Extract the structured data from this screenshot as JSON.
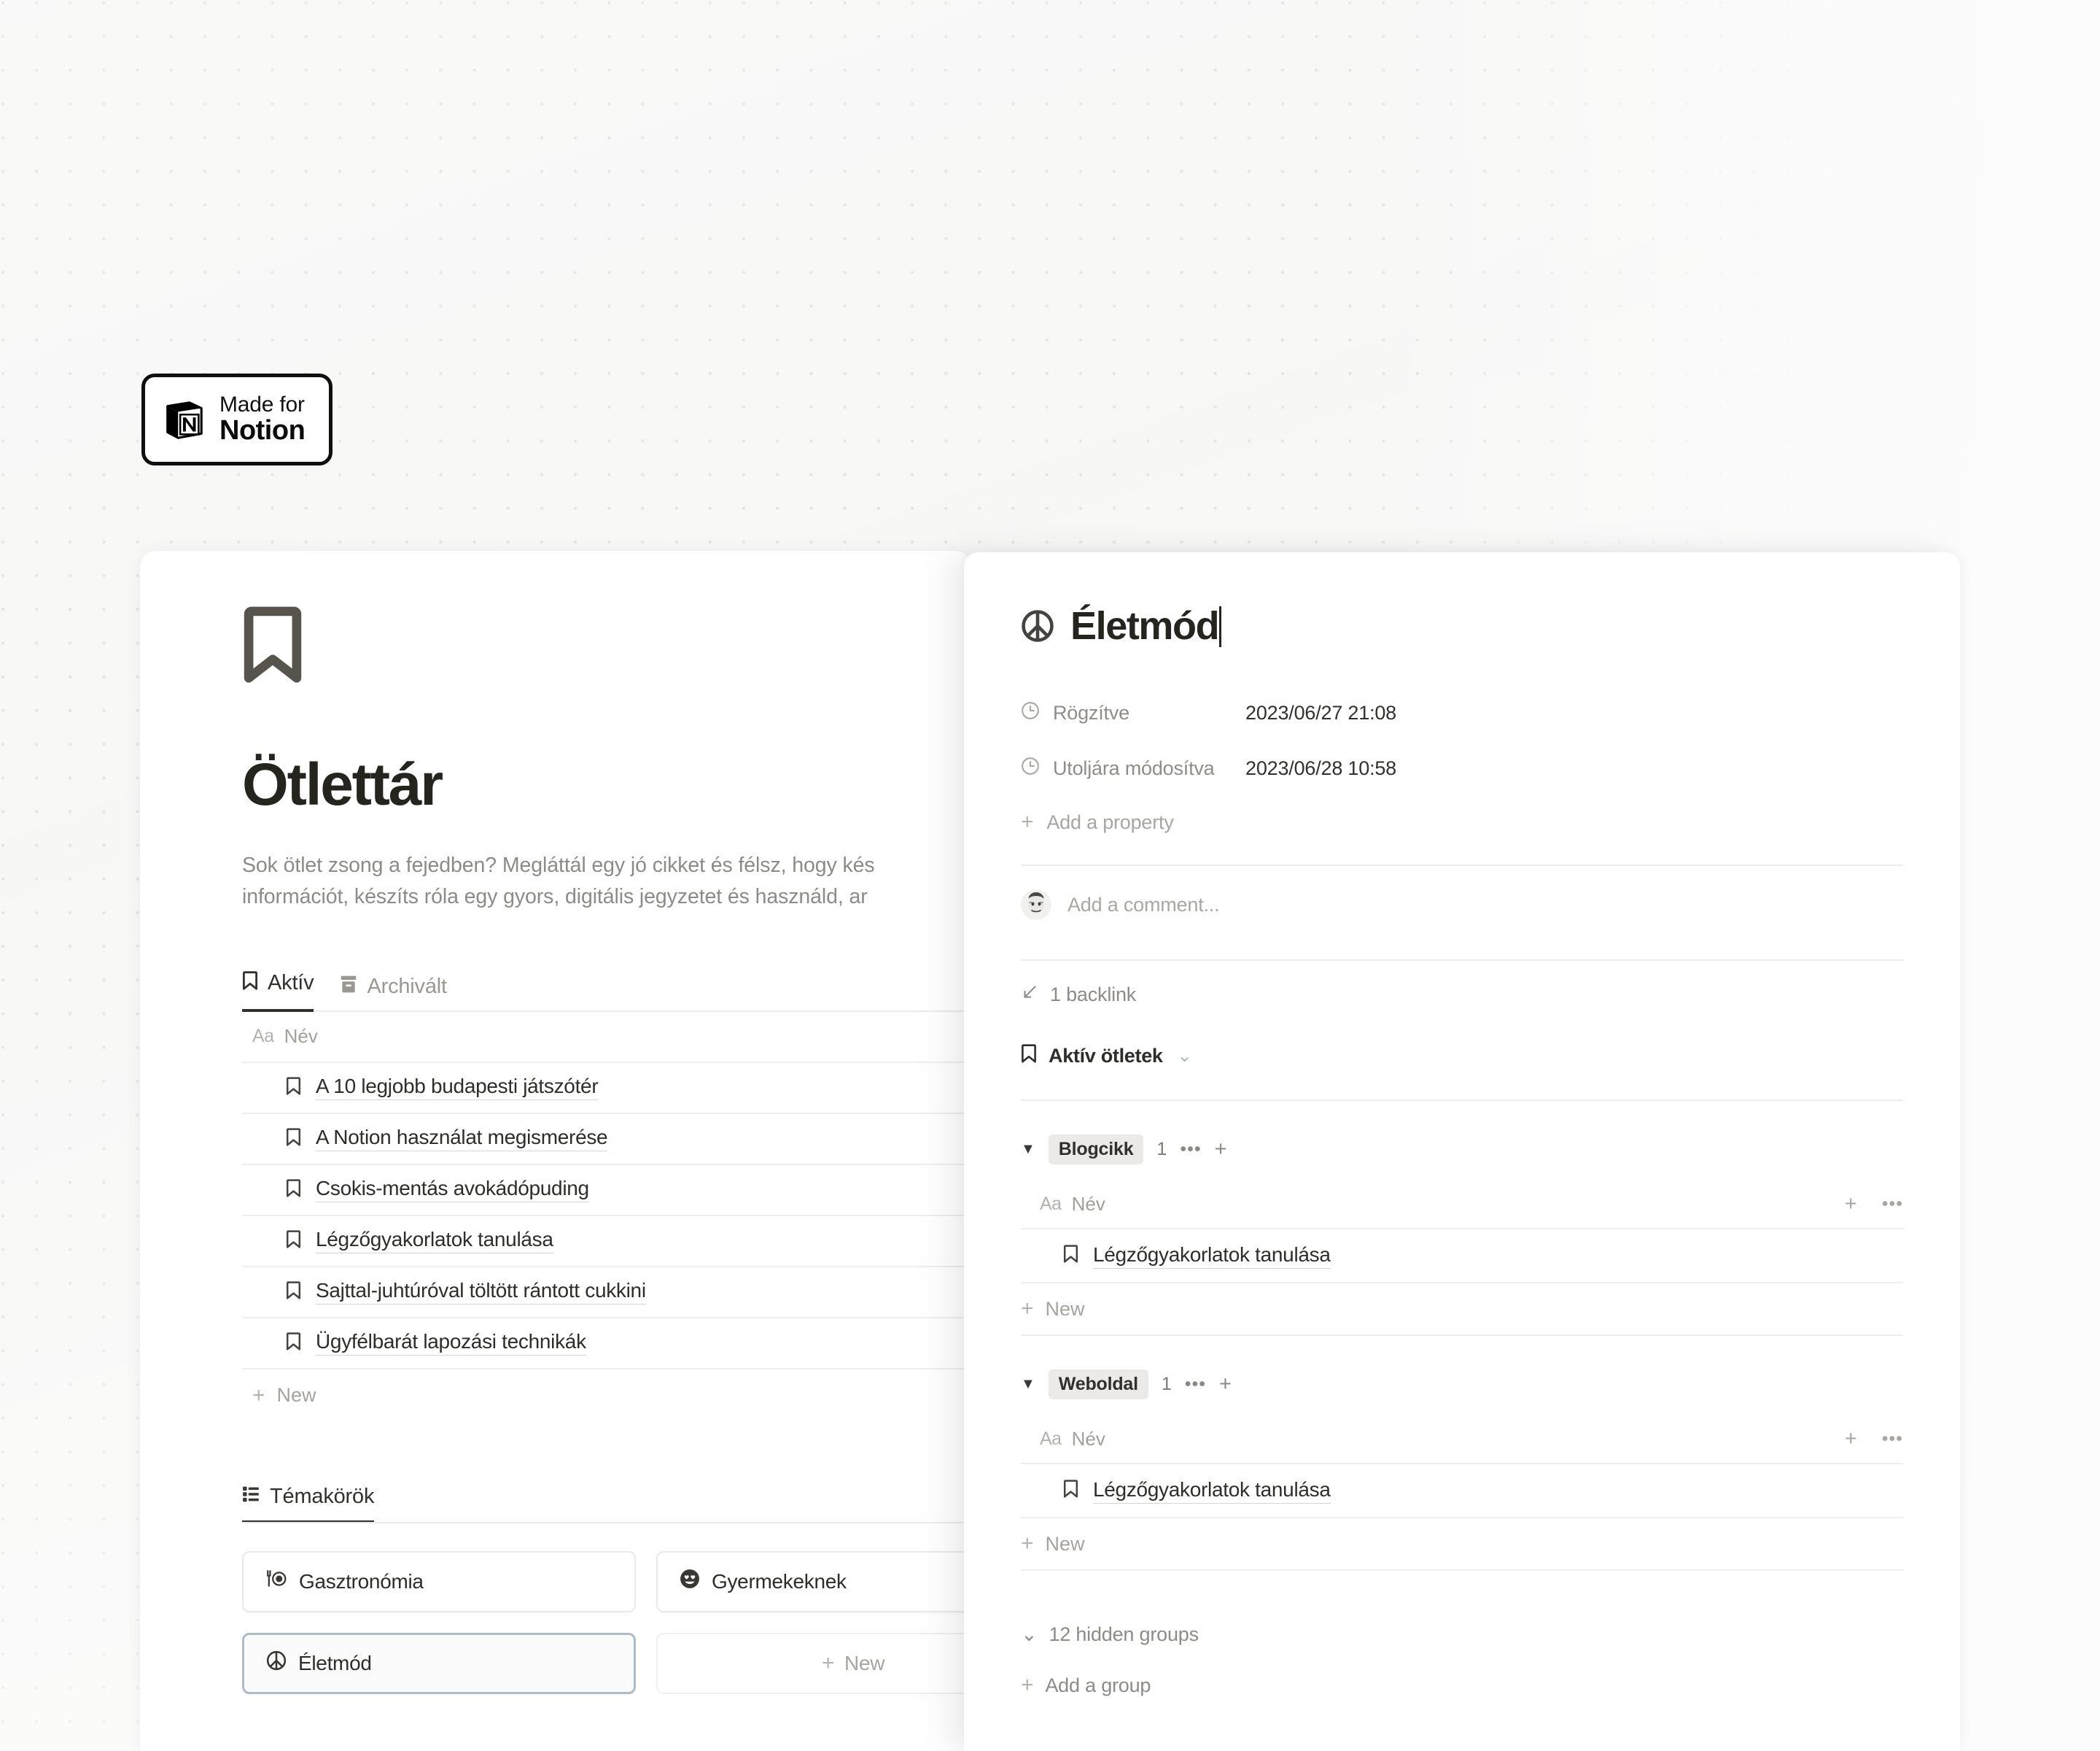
{
  "badge": {
    "line1": "Made for",
    "line2": "Notion",
    "logo_icon": "notion-logo-icon"
  },
  "left_page": {
    "hero_icon": "bookmark-icon",
    "title": "Ötlettár",
    "description_line1": "Sok ötlet zsong a fejedben? Megláttál egy jó cikket és félsz, hogy kés",
    "description_line2": "információt, készíts róla egy gyors, digitális jegyzetet és használd, ar",
    "tabs": [
      {
        "label": "Aktív",
        "icon": "bookmark-icon",
        "active": true
      },
      {
        "label": "Archivált",
        "icon": "archive-box-icon",
        "active": false
      }
    ],
    "table": {
      "column_header": "Név",
      "column_type_glyph": "Aa",
      "rows": [
        {
          "icon": "bookmark-icon",
          "title": "A 10 legjobb budapesti játszótér"
        },
        {
          "icon": "bookmark-icon",
          "title": "A Notion használat megismerése"
        },
        {
          "icon": "bookmark-icon",
          "title": "Csokis-mentás avokádópuding"
        },
        {
          "icon": "bookmark-icon",
          "title": "Légzőgyakorlatok tanulása"
        },
        {
          "icon": "bookmark-icon",
          "title": "Sajttal-juhtúróval töltött rántott cukkini"
        },
        {
          "icon": "bookmark-icon",
          "title": "Ügyfélbarát lapozási technikák"
        }
      ],
      "new_label": "New"
    },
    "topics_section": {
      "tab_label": "Témakörök",
      "tab_icon": "gallery-view-icon",
      "cards": [
        {
          "label": "Gasztronómia",
          "icon": "fork-plate-icon",
          "selected": false
        },
        {
          "label": "Gyermekeknek",
          "icon": "heart-eyes-emoji-icon",
          "selected": false
        },
        {
          "label": "Életmód",
          "icon": "peace-sign-icon",
          "selected": true
        }
      ],
      "new_label": "New"
    }
  },
  "right_panel": {
    "title": "Életmód",
    "title_icon": "peace-sign-icon",
    "properties": [
      {
        "icon": "clock-icon",
        "label": "Rögzítve",
        "value": "2023/06/27 21:08"
      },
      {
        "icon": "clock-icon",
        "label": "Utoljára módosítva",
        "value": "2023/06/28 10:58"
      }
    ],
    "add_property_label": "Add a property",
    "comment_placeholder": "Add a comment...",
    "comment_avatar_icon": "user-avatar-icon",
    "backlink_label": "1 backlink",
    "backlink_icon": "arrow-down-left-icon",
    "backlink_source": "Aktív ötletek",
    "backlink_source_icon": "bookmark-icon",
    "groups": [
      {
        "name": "Blogcikk",
        "count": "1",
        "column_header": "Név",
        "column_type_glyph": "Aa",
        "rows": [
          {
            "icon": "bookmark-icon",
            "title": "Légzőgyakorlatok tanulása"
          }
        ],
        "new_label": "New"
      },
      {
        "name": "Weboldal",
        "count": "1",
        "column_header": "Név",
        "column_type_glyph": "Aa",
        "rows": [
          {
            "icon": "bookmark-icon",
            "title": "Légzőgyakorlatok tanulása"
          }
        ],
        "new_label": "New"
      }
    ],
    "hidden_groups_label": "12 hidden groups",
    "add_group_label": "Add a group"
  },
  "colors": {
    "background": "#f7f7f6",
    "card": "#ffffff",
    "text_primary": "#26241f",
    "text_muted": "#8d8b87",
    "selected_border": "#aebcc8",
    "chip_bg": "#eceae8"
  }
}
